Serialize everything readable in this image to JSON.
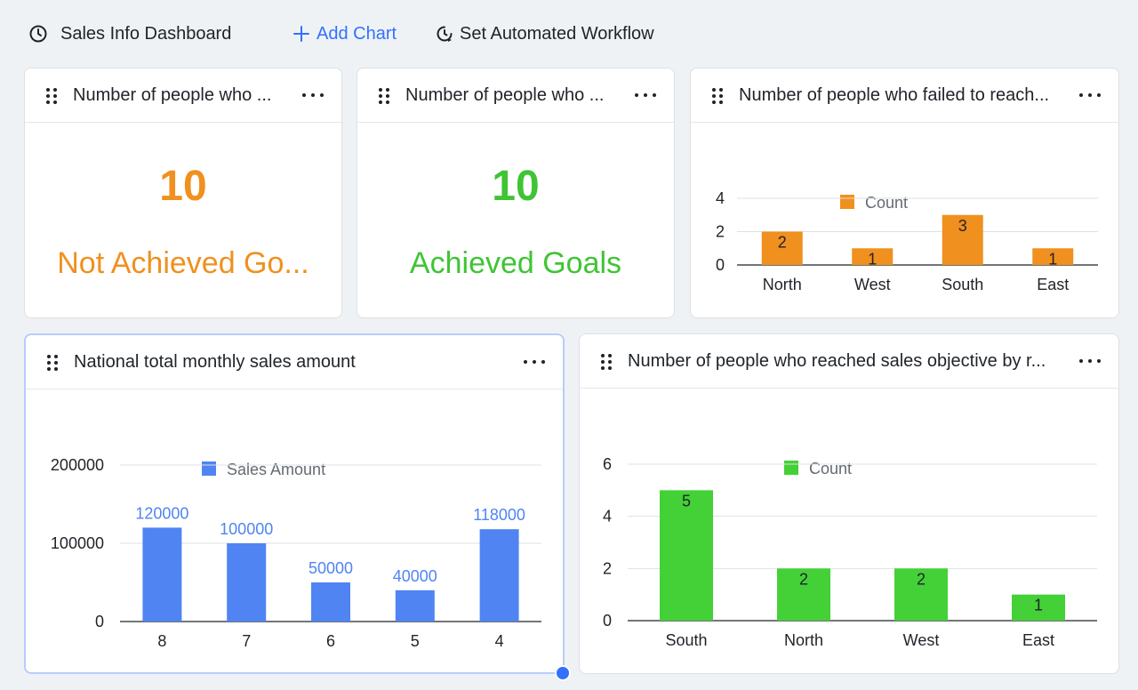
{
  "toolbar": {
    "title": "Sales Info Dashboard",
    "title_icon": "clock-icon",
    "add_chart_label": "Add Chart",
    "add_icon": "plus-icon",
    "workflow_label": "Set Automated Workflow",
    "workflow_icon": "automation-icon",
    "accent_color": "#3370ff"
  },
  "cards": {
    "not_achieved": {
      "title": "Number of people who ...",
      "value": "10",
      "label": "Not Achieved Go...",
      "color": "#f0901e"
    },
    "achieved": {
      "title": "Number of people who ...",
      "value": "10",
      "label": "Achieved Goals",
      "color": "#3fc435"
    },
    "failed_by_region": {
      "title": "Number of people who failed to reach...",
      "legend": "Count",
      "color": "#f0901e"
    },
    "monthly_sales": {
      "title": "National total monthly sales amount",
      "legend": "Sales Amount",
      "color": "#5084f2"
    },
    "reached_by_region": {
      "title": "Number of people who reached sales objective by r...",
      "legend": "Count",
      "color": "#43d137"
    }
  },
  "chart_data": [
    {
      "type": "bar",
      "title": "Number of people who failed to reach...",
      "categories": [
        "North",
        "West",
        "South",
        "East"
      ],
      "series": [
        {
          "name": "Count",
          "values": [
            2,
            1,
            3,
            1
          ]
        }
      ],
      "yticks": [
        0,
        2,
        4
      ],
      "ylim": [
        0,
        4
      ],
      "legend": "top",
      "grid": true
    },
    {
      "type": "bar",
      "title": "National total monthly sales amount",
      "categories": [
        "8",
        "7",
        "6",
        "5",
        "4"
      ],
      "series": [
        {
          "name": "Sales Amount",
          "values": [
            120000,
            100000,
            50000,
            40000,
            118000
          ]
        }
      ],
      "yticks": [
        0,
        100000,
        200000
      ],
      "ylim": [
        0,
        200000
      ],
      "legend": "top",
      "grid": true
    },
    {
      "type": "bar",
      "title": "Number of people who reached sales objective by r...",
      "categories": [
        "South",
        "North",
        "West",
        "East"
      ],
      "series": [
        {
          "name": "Count",
          "values": [
            5,
            2,
            2,
            1
          ]
        }
      ],
      "yticks": [
        0,
        2,
        4,
        6
      ],
      "ylim": [
        0,
        6
      ],
      "legend": "top",
      "grid": true
    }
  ]
}
